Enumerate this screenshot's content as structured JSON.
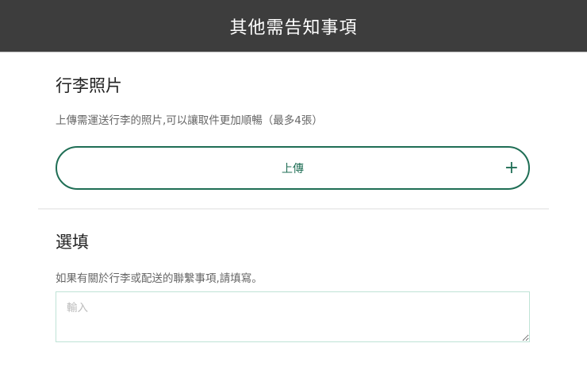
{
  "header": {
    "title": "其他需告知事項"
  },
  "photos": {
    "title": "行李照片",
    "description": "上傳需運送行李的照片,可以讓取件更加順暢（最多4張）",
    "upload_label": "上傳",
    "upload_icon": "plus-icon",
    "plus_glyph": "+"
  },
  "optional": {
    "title": "選填",
    "description": "如果有關於行李或配送的聯繫事項,請填寫。",
    "input_placeholder": "輸入",
    "input_value": ""
  },
  "colors": {
    "header_bg": "#3d3d3d",
    "accent": "#1f6e55",
    "input_border": "#bfe3d6"
  }
}
